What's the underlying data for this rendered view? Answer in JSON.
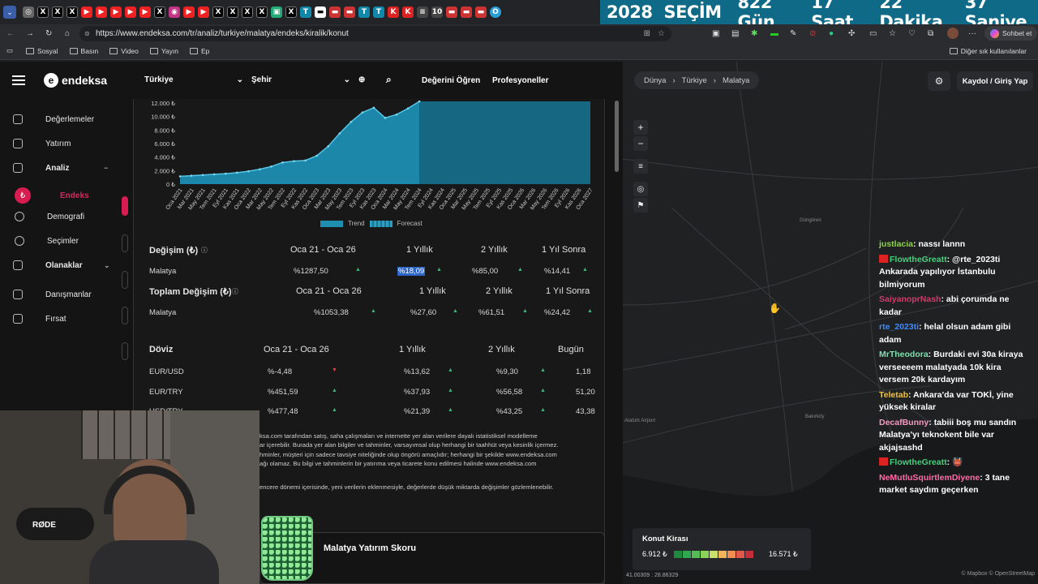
{
  "countdown": {
    "year": "2028",
    "label": "SEÇİM",
    "days": "822 Gün",
    "hours": "17 Saat",
    "minutes": "22 Dakika",
    "seconds": "37 Saniye"
  },
  "browser": {
    "url": "https://www.endeksa.com/tr/analiz/turkiye/malatya/endeks/kiralik/konut",
    "chat_button": "Sohbet et",
    "other_bookmarks": "Diğer sık kullanılanlar",
    "bookmarks": [
      "Sosyal",
      "Basın",
      "Video",
      "Yayın",
      "Ep"
    ]
  },
  "site": {
    "logo": "endeksa",
    "country": "Türkiye",
    "city": "Şehir",
    "nav_valuation": "Değerini Öğren",
    "nav_pro": "Profesyoneller",
    "sidebar": [
      {
        "label": "Değerlemeler",
        "icon": "home-icon"
      },
      {
        "label": "Yatırım",
        "icon": "grid-icon"
      },
      {
        "label": "Analiz",
        "icon": "chart-icon",
        "expanded": true
      },
      {
        "label": "Endeks",
        "icon": "lira-icon",
        "active": true
      },
      {
        "label": "Demografi",
        "icon": "people-icon"
      },
      {
        "label": "Seçimler",
        "icon": "ballot-icon"
      },
      {
        "label": "Olanaklar",
        "icon": "location-icon"
      },
      {
        "label": "Danışmanlar",
        "icon": "person-icon"
      },
      {
        "label": "Fırsat",
        "icon": "target-icon"
      }
    ]
  },
  "chart_data": {
    "type": "area",
    "yticks": [
      "12.000 ₺",
      "10.000 ₺",
      "8.000 ₺",
      "6.000 ₺",
      "4.000 ₺",
      "2.000 ₺",
      "0 ₺"
    ],
    "ylim": [
      0,
      12500
    ],
    "categories": [
      "Oca 2021",
      "Mar 2021",
      "May 2021",
      "Tem 2021",
      "Eyl 2021",
      "Kas 2021",
      "Oca 2022",
      "Mar 2022",
      "May 2022",
      "Tem 2022",
      "Eyl 2022",
      "Kas 2022",
      "Oca 2023",
      "Mar 2023",
      "May 2023",
      "Tem 2023",
      "Eyl 2023",
      "Kas 2023",
      "Oca 2024",
      "Mar 2024",
      "May 2024",
      "Tem 2024",
      "Eyl 2024",
      "Kas 2024",
      "Oca 2025",
      "Mar 2025",
      "May 2025",
      "Tem 2025",
      "Eyl 2025",
      "Kas 2025",
      "Oca 2026",
      "Mar 2026",
      "May 2026",
      "Tem 2026",
      "Eyl 2026",
      "Kas 2026",
      "Oca 2027"
    ],
    "series": [
      {
        "name": "Trend",
        "values": [
          1150,
          1250,
          1350,
          1450,
          1550,
          1700,
          1900,
          2200,
          2600,
          3200,
          3400,
          3500,
          4200,
          5600,
          7500,
          9200,
          10600,
          11300,
          9800,
          10300,
          11200,
          13000
        ]
      },
      {
        "name": "Forecast",
        "values": [
          13000,
          14000,
          14800,
          15300,
          15700,
          16000,
          16300,
          16600,
          16900,
          17100,
          17300,
          17500,
          17700,
          17900,
          18000
        ]
      }
    ],
    "legend": [
      "Trend",
      "Forecast"
    ],
    "legend_position": "bottom",
    "forecast_start_index": 21
  },
  "change_table": {
    "title": "Değişim (₺)",
    "cols": [
      "Oca 21 - Oca 26",
      "1 Yıllık",
      "2 Yıllık",
      "1 Yıl Sonra"
    ],
    "rows": [
      {
        "name": "Malatya",
        "values": [
          "%1287,50",
          "%18,09",
          "%85,00",
          "%14,41"
        ]
      }
    ]
  },
  "total_table": {
    "title": "Toplam Değişim (₺)",
    "cols": [
      "Oca 21 - Oca 26",
      "1 Yıllık",
      "2 Yıllık",
      "1 Yıl Sonra"
    ],
    "rows": [
      {
        "name": "Malatya",
        "values": [
          "%1053,38",
          "%27,60",
          "%61,51",
          "%24,42"
        ]
      }
    ]
  },
  "fx_table": {
    "title": "Döviz",
    "cols": [
      "Oca 21 - Oca 26",
      "1 Yıllık",
      "2 Yıllık",
      "Bugün"
    ],
    "rows": [
      {
        "name": "EUR/USD",
        "values": [
          "%-4,48",
          "%13,62",
          "%9,30",
          "1,18"
        ],
        "trend": "down"
      },
      {
        "name": "EUR/TRY",
        "values": [
          "%451,59",
          "%37,93",
          "%56,58",
          "51,20"
        ],
        "trend": "up"
      },
      {
        "name": "USD/TRY",
        "values": [
          "%477,48",
          "%21,39",
          "%43,25",
          "43,38"
        ],
        "trend": "up"
      }
    ]
  },
  "disclaimer": [
    "ksa.com tarafından satış, saha çalışmaları ve internette yer alan verilere dayalı istatistiksel modelleme",
    "ar içerebilir. Burada yer alan bilgiler ve tahminler, varsayımsal olup herhangi bir taahhüt veya kesinlik içermez.",
    "hminler, müşteri için sadece tavsiye niteliğinde olup öngörü amaçlıdır; herhangi bir şekilde www.endeksa.com",
    "ağı olamaz. Bu bilgi ve tahminlerin bir yatırıma veya ticarete konu edilmesi halinde www.endeksa.com",
    "encere dönemi içerisinde, yeni verilerin eklenmesiyle, değerlerde düşük miktarda değişimler gözlemlenebilir."
  ],
  "investment_card": {
    "title": "Malatya Yatırım Skoru"
  },
  "map": {
    "crumbs": [
      "Dünya",
      "Türkiye",
      "Malatya"
    ],
    "login": "Kaydol / Giriş Yap",
    "legend_title": "Konut Kirası",
    "legend_min": "6.912 ₺",
    "legend_max": "16.571 ₺",
    "legend_colors": [
      "#1f8a3f",
      "#2fa84f",
      "#55bb55",
      "#8cd35a",
      "#c7e06a",
      "#f2b35a",
      "#f08f4f",
      "#e0584a",
      "#c42d3a"
    ],
    "coords": "41.00309 : 28.86329",
    "attribution": "© Mapbox © OpenStreetMap",
    "places": [
      "Güngören",
      "Bakırköy",
      "Atatürk Airport"
    ]
  },
  "chat": [
    {
      "user": "justlacia",
      "color": "#8fd14f",
      "msg": "nassı lannn"
    },
    {
      "user": "FlowtheGreatt",
      "color": "#44d17a",
      "msg": "@rte_2023ti Ankarada yapılıyor İstanbulu bilmiyorum",
      "badge": true
    },
    {
      "user": "SaiyanoprNash",
      "color": "#d33a6a",
      "msg": "abi çorumda ne kadar"
    },
    {
      "user": "rte_2023ti",
      "color": "#3b8cff",
      "msg": "helal olsun adam gibi adam"
    },
    {
      "user": "MrTheodora",
      "color": "#7fe0b0",
      "msg": "Burdaki evi 30a kiraya verseeeem malatyada 10k kira versem 20k kardayım"
    },
    {
      "user": "Teletab",
      "color": "#f3c23b",
      "msg": "Ankara'da var TOKİ, yine yüksek kiralar"
    },
    {
      "user": "DecafBunny",
      "color": "#f29bc0",
      "msg": "tabiii boş mu sandın Malatya'yı teknokent bile var akjajsashd"
    },
    {
      "user": "FlowtheGreatt",
      "color": "#44d17a",
      "msg": "👹",
      "badge": true
    },
    {
      "user": "NeMutluSquirtlemDiyene",
      "color": "#ff6aa7",
      "msg": "3 tane market saydım geçerken"
    }
  ],
  "webcam": {
    "mic_brand": "RØDE"
  }
}
